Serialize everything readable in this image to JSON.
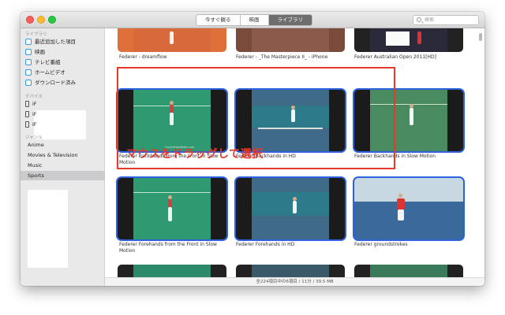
{
  "toolbar": {
    "tabs": [
      {
        "label": "今すぐ観る",
        "active": false
      },
      {
        "label": "映画",
        "active": false
      },
      {
        "label": "ライブラリ",
        "active": true
      }
    ],
    "search_placeholder": "検索"
  },
  "sidebar": {
    "library_header": "ライブラリ",
    "library_items": [
      {
        "label": "最近追加した項目"
      },
      {
        "label": "映画"
      },
      {
        "label": "テレビ番組"
      },
      {
        "label": "ホームビデオ"
      },
      {
        "label": "ダウンロード済み"
      }
    ],
    "devices_header": "デバイス",
    "device_items": [
      {
        "label": "iF"
      },
      {
        "label": "iF"
      },
      {
        "label": "iF"
      }
    ],
    "genres_header": "ジャンル",
    "genres": [
      {
        "label": "Anime",
        "selected": false
      },
      {
        "label": "Movies & Television",
        "selected": false
      },
      {
        "label": "Music",
        "selected": false
      },
      {
        "label": "Sports",
        "selected": true
      }
    ]
  },
  "grid": {
    "items": [
      {
        "title": "Federer -  dreamflow",
        "selected": false
      },
      {
        "title": "Federer - _The Masterpiece II_ - iPhone",
        "selected": false
      },
      {
        "title": "Federer Australian Open 2011[HD]",
        "selected": false
      },
      {
        "title": "Federer Backhands from the Front in Slow Motion",
        "selected": true
      },
      {
        "title": "Federer Backhands in HD",
        "selected": true
      },
      {
        "title": "Federer Backhands in Slow Motion",
        "selected": true
      },
      {
        "title": "Federer Forehands from the Front in Slow Motion",
        "selected": true
      },
      {
        "title": "Federer Forehands in HD",
        "selected": true
      },
      {
        "title": "Federer groundstrokes",
        "selected": true
      },
      {
        "title": "",
        "selected": false
      },
      {
        "title": "",
        "selected": false
      },
      {
        "title": "",
        "selected": false
      }
    ],
    "watermark": "FuzzyYellowBalls.com"
  },
  "status": {
    "text": "全224項目中の6項目 / 11分 / 39.5 MB"
  },
  "annotation": {
    "text": "マウスをドラッグして選択"
  },
  "colors": {
    "accent": "#2c62e0",
    "annotation": "#e8382b",
    "sidebar_icon": "#2f9fe0"
  }
}
